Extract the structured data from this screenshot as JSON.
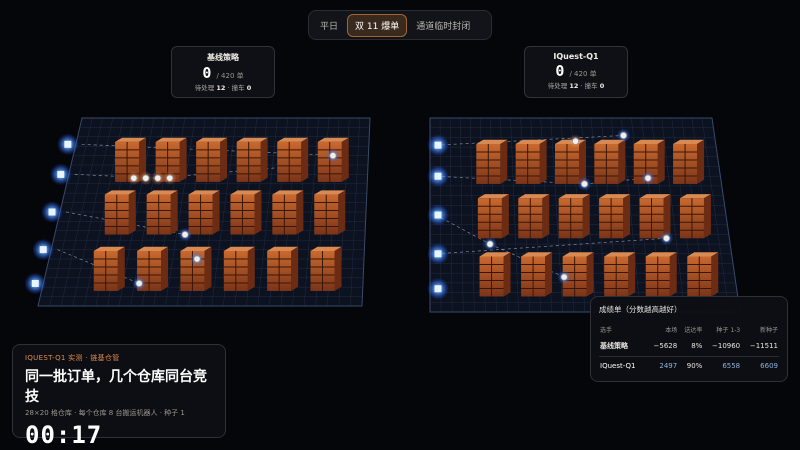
{
  "tabs": [
    {
      "label": "平日",
      "active": false
    },
    {
      "label": "双 11 爆单",
      "active": true
    },
    {
      "label": "通道临时封闭",
      "active": false
    }
  ],
  "warehouses": [
    {
      "name": "基线策略",
      "delivered": "0",
      "total": "/ 420 单",
      "pending_label": "待处理",
      "pending": "12",
      "collision_label": "撞车",
      "collisions": "0",
      "separator": "·"
    },
    {
      "name": "IQuest-Q1",
      "delivered": "0",
      "total": "/ 420 单",
      "pending_label": "待处理",
      "pending": "12",
      "collision_label": "撞车",
      "collisions": "0",
      "separator": "·"
    }
  ],
  "intro": {
    "kicker": "IQUEST-Q1 实测 · 链基仓管",
    "headline": "同一批订单，几个仓库同台竞技",
    "desc": "28×20 格仓库 · 每个仓库 8 台搬运机器人 · 种子 1",
    "timer": "00:17"
  },
  "leaderboard": {
    "title": "成绩单（分数越高越好）",
    "columns": [
      "选手",
      "本场",
      "送达率",
      "种子 1-3",
      "新种子"
    ],
    "rows": [
      [
        "基线策略",
        "−5628",
        "8%",
        "−10960",
        "−11511"
      ],
      [
        "IQuest-Q1",
        "2497",
        "90%",
        "6558",
        "6609"
      ]
    ]
  },
  "colors": {
    "accent": "#e08b4e",
    "shelf": "#b5562a",
    "robot_glow": "#5aa8ff",
    "grid": "#2a3550",
    "blue_value": "#8fb3d9"
  },
  "icons": [
    "dock-light-icon",
    "robot-icon",
    "shelf-icon"
  ]
}
